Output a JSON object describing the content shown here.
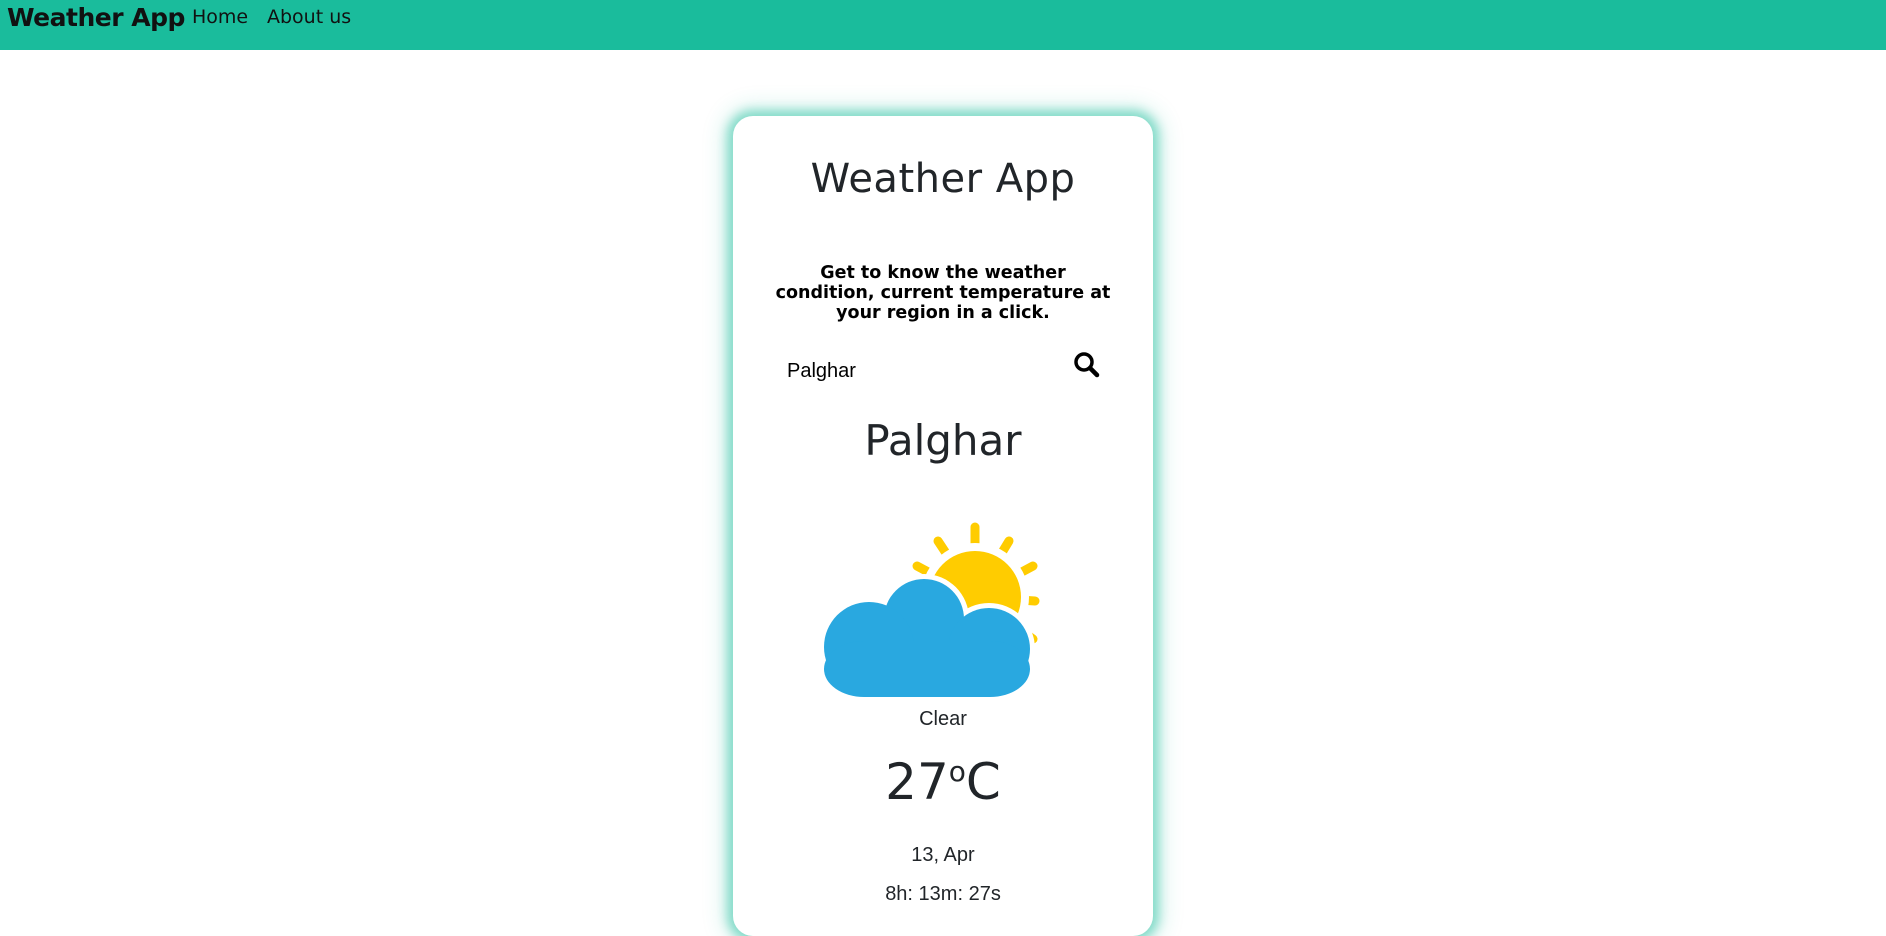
{
  "navbar": {
    "brand": "Weather App",
    "links": [
      {
        "label": "Home"
      },
      {
        "label": "About us"
      }
    ],
    "background": "#1abc9c"
  },
  "card": {
    "title": "Weather App",
    "tagline": "Get to know the weather condition, current temperature at your region in a click.",
    "search": {
      "value": "Palghar",
      "icon": "search-icon"
    },
    "city": "Palghar",
    "weather_icon": "partly-cloudy-icon",
    "condition": "Clear",
    "temperature": {
      "value": "27",
      "degree": "o",
      "unit": "C"
    },
    "date": "13, Apr",
    "time": "8h: 13m: 27s",
    "glow_color": "#1abc9c",
    "sun_color": "#ffcc00",
    "cloud_color": "#29a8e0"
  }
}
